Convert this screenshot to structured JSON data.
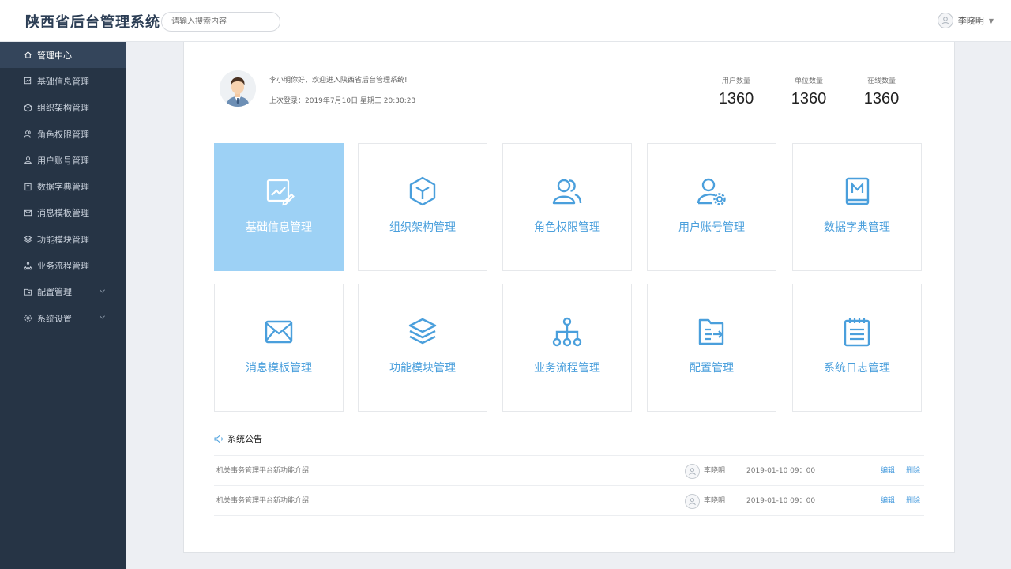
{
  "header": {
    "title": "陕西省后台管理系统",
    "search_placeholder": "请输入搜索内容",
    "user_name": "李晓明"
  },
  "sidebar": {
    "items": [
      {
        "label": "管理中心",
        "icon": "home-icon",
        "active": true
      },
      {
        "label": "基础信息管理",
        "icon": "edit-chart-icon"
      },
      {
        "label": "组织架构管理",
        "icon": "cube-icon"
      },
      {
        "label": "角色权限管理",
        "icon": "users-icon"
      },
      {
        "label": "用户账号管理",
        "icon": "user-icon"
      },
      {
        "label": "数据字典管理",
        "icon": "book-icon"
      },
      {
        "label": "消息模板管理",
        "icon": "mail-icon"
      },
      {
        "label": "功能模块管理",
        "icon": "layers-icon"
      },
      {
        "label": "业务流程管理",
        "icon": "flow-icon"
      },
      {
        "label": "配置管理",
        "icon": "folder-icon",
        "expandable": true
      },
      {
        "label": "系统设置",
        "icon": "gear-icon",
        "expandable": true
      }
    ]
  },
  "welcome": {
    "greeting": "李小明你好，欢迎进入陕西省后台管理系统!",
    "last_login": "上次登录：2019年7月10日 星期三 20:30:23"
  },
  "stats": [
    {
      "label": "用户数量",
      "value": "1360"
    },
    {
      "label": "单位数量",
      "value": "1360"
    },
    {
      "label": "在线数量",
      "value": "1360"
    }
  ],
  "tiles": [
    {
      "label": "基础信息管理",
      "icon": "edit-chart-icon",
      "selected": true
    },
    {
      "label": "组织架构管理",
      "icon": "cube-icon"
    },
    {
      "label": "角色权限管理",
      "icon": "users-icon"
    },
    {
      "label": "用户账号管理",
      "icon": "user-gear-icon"
    },
    {
      "label": "数据字典管理",
      "icon": "book-icon"
    },
    {
      "label": "消息模板管理",
      "icon": "mail-icon"
    },
    {
      "label": "功能模块管理",
      "icon": "layers-icon"
    },
    {
      "label": "业务流程管理",
      "icon": "flow-icon"
    },
    {
      "label": "配置管理",
      "icon": "folder-arrow-icon"
    },
    {
      "label": "系统日志管理",
      "icon": "notepad-icon"
    }
  ],
  "notices": {
    "title": "系统公告",
    "rows": [
      {
        "title": "机关事务管理平台新功能介绍",
        "author": "李晓明",
        "date": "2019-01-10 09：00",
        "edit": "编辑",
        "delete": "删除"
      },
      {
        "title": "机关事务管理平台新功能介绍",
        "author": "李晓明",
        "date": "2019-01-10 09：00",
        "edit": "编辑",
        "delete": "删除"
      }
    ]
  },
  "colors": {
    "sidebar_bg": "#263445",
    "sidebar_active": "#34455b",
    "accent": "#4a9fdc",
    "tile_selected": "#9dd1f5"
  }
}
